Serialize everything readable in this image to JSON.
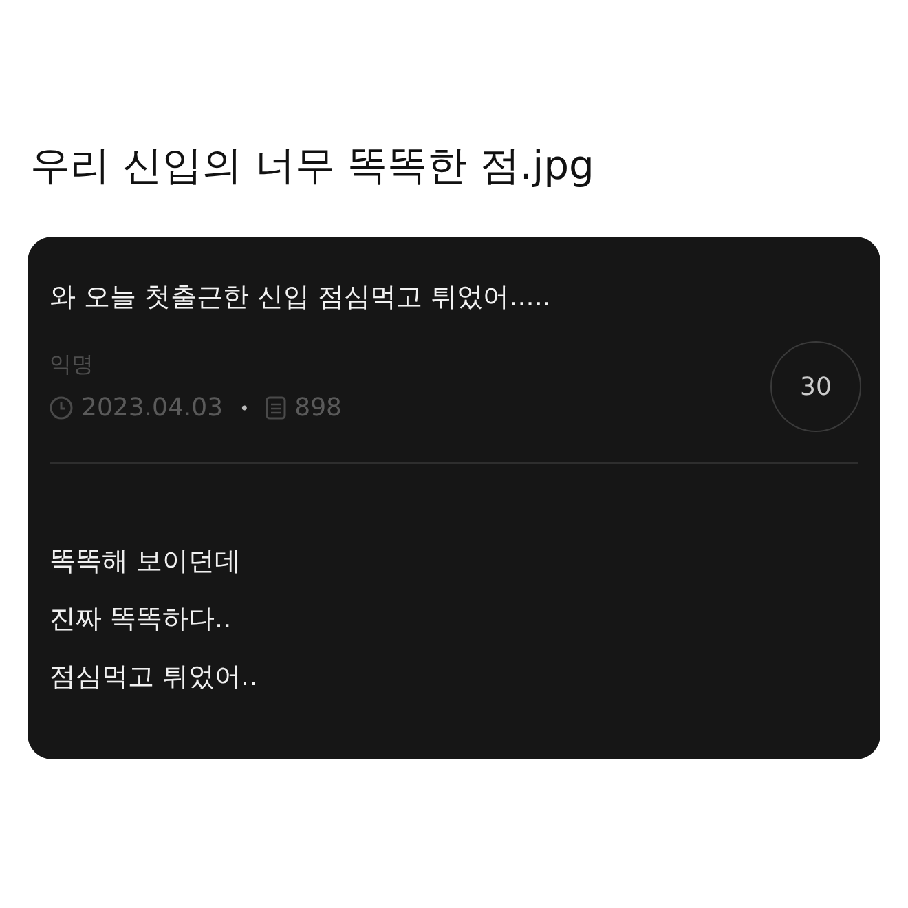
{
  "page_title": "우리 신입의 너무 똑똑한 점.jpg",
  "post": {
    "title": "와 오늘 첫출근한 신입 점심먹고 튀었어.....",
    "author": "익명",
    "date": "2023.04.03",
    "separator": "•",
    "views": "898",
    "comments": "30",
    "body": [
      "똑똑해 보이던데",
      "진짜 똑똑하다..",
      "점심먹고 튀었어.."
    ]
  }
}
